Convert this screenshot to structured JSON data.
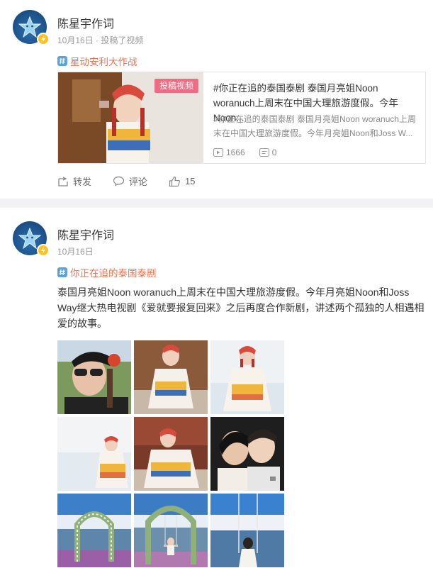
{
  "post1": {
    "username": "陈星宇作词",
    "meta": "10月16日 · 投稿了视频",
    "topic": "星动安利大作战",
    "link_card": {
      "badge": "投稿视频",
      "title": "#你正在追的泰国泰剧 泰国月亮姐Noon woranuch上周末在中国大理旅游度假。今年Noon...",
      "description": "#你正在追的泰国泰剧 泰国月亮姐Noon woranuch上周末在中国大理旅游度假。今年月亮姐Noon和Joss W...",
      "plays": "1666",
      "comments": "0"
    },
    "actions": {
      "repost": "转发",
      "comment": "评论",
      "like": "15"
    }
  },
  "post2": {
    "username": "陈星宇作词",
    "meta": "10月16日",
    "topic": "你正在追的泰国泰剧",
    "text": "泰国月亮姐Noon woranuch上周末在中国大理旅游度假。今年月亮姐Noon和Joss Way继大热电视剧《爱就要报复回来》之后再度合作新剧，讲述两个孤独的人相遇相爱的故事。"
  },
  "icons": {
    "topic": "hashtag-icon",
    "repost": "repost-icon",
    "comment": "comment-icon",
    "like": "thumbs-up-icon",
    "plays": "play-icon",
    "comments": "comment-count-icon",
    "verified": "verified-badge-icon"
  },
  "colors": {
    "topic": "#eb7350",
    "badge": "#ef6c84",
    "verified": "#ffc122",
    "background": "#f2f2f5"
  }
}
